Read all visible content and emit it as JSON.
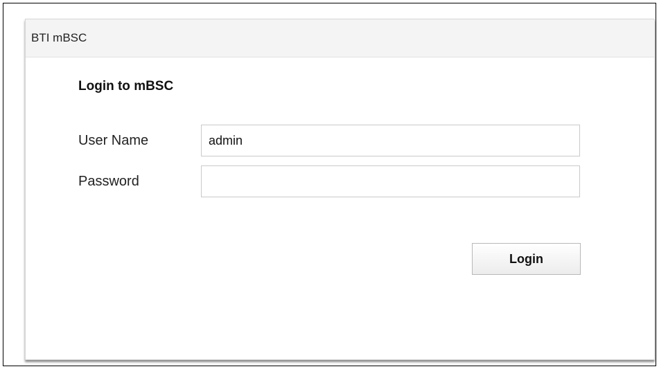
{
  "panel": {
    "title": "BTI mBSC"
  },
  "form": {
    "heading": "Login to mBSC",
    "username": {
      "label": "User Name",
      "value": "admin"
    },
    "password": {
      "label": "Password",
      "value": ""
    },
    "login_label": "Login"
  }
}
